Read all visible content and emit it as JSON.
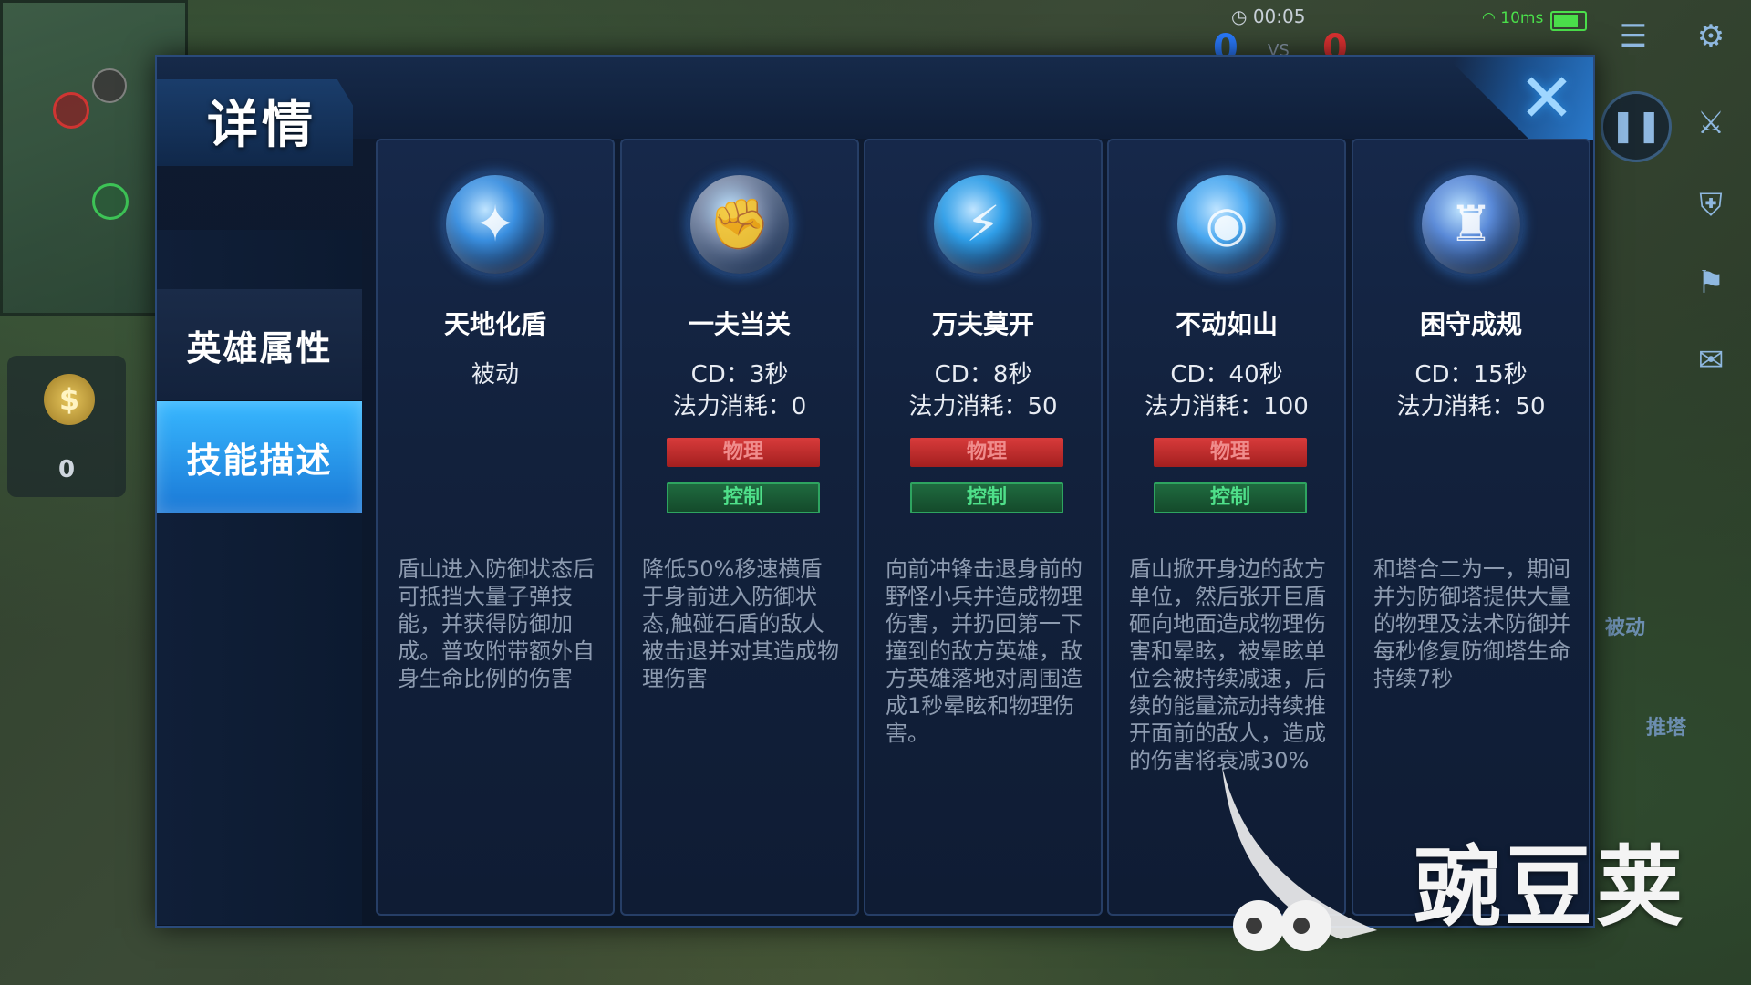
{
  "hud": {
    "timer": "00:05",
    "score_blue": "0",
    "score_red": "0",
    "vs": "VS",
    "ping": "10ms",
    "gold": "0",
    "side_labels": [
      "被动",
      "推塔"
    ]
  },
  "dialog": {
    "title": "详情",
    "close_symbol": "✕",
    "tabs": [
      {
        "label": "英雄属性",
        "active": false
      },
      {
        "label": "技能描述",
        "active": true
      }
    ]
  },
  "skills": [
    {
      "name": "天地化盾",
      "icon": "shield-blast-icon",
      "cd": "被动",
      "cost": "",
      "tags": [],
      "description": "盾山进入防御状态后可抵挡大量子弹技能，并获得防御加成。普攻附带额外自身生命比例的伤害",
      "accent": "#3a8fe0"
    },
    {
      "name": "一夫当关",
      "icon": "fist-shield-icon",
      "cd": "CD：3秒",
      "cost": "法力消耗：0",
      "tags": [
        "物理",
        "控制"
      ],
      "description": "降低50%移速横盾于身前进入防御状态,触碰石盾的敌人被击退并对其造成物理伤害",
      "accent": "#7a8aa8"
    },
    {
      "name": "万夫莫开",
      "icon": "charging-hero-icon",
      "cd": "CD：8秒",
      "cost": "法力消耗：50",
      "tags": [
        "物理",
        "控制"
      ],
      "description": "向前冲锋击退身前的野怪小兵并造成物理伤害，并扔回第一下撞到的敌方英雄，敌方英雄落地对周围造成1秒晕眩和物理伤害。",
      "accent": "#2f9ee8"
    },
    {
      "name": "不动如山",
      "icon": "ground-slam-icon",
      "cd": "CD：40秒",
      "cost": "法力消耗：100",
      "tags": [
        "物理",
        "控制"
      ],
      "description": "盾山掀开身边的敌方单位，然后张开巨盾砸向地面造成物理伤害和晕眩，被晕眩单位会被持续减速，后续的能量流动持续推开面前的敌人，造成的伤害将衰减30%",
      "accent": "#4aa8f0"
    },
    {
      "name": "困守成规",
      "icon": "tower-guard-icon",
      "cd": "CD：15秒",
      "cost": "法力消耗：50",
      "tags": [],
      "description": "和塔合二为一，期间并为防御塔提供大量的物理及法术防御并每秒修复防御塔生命持续7秒",
      "accent": "#5a8ad8"
    }
  ],
  "watermark": {
    "text": "豌豆荚"
  }
}
